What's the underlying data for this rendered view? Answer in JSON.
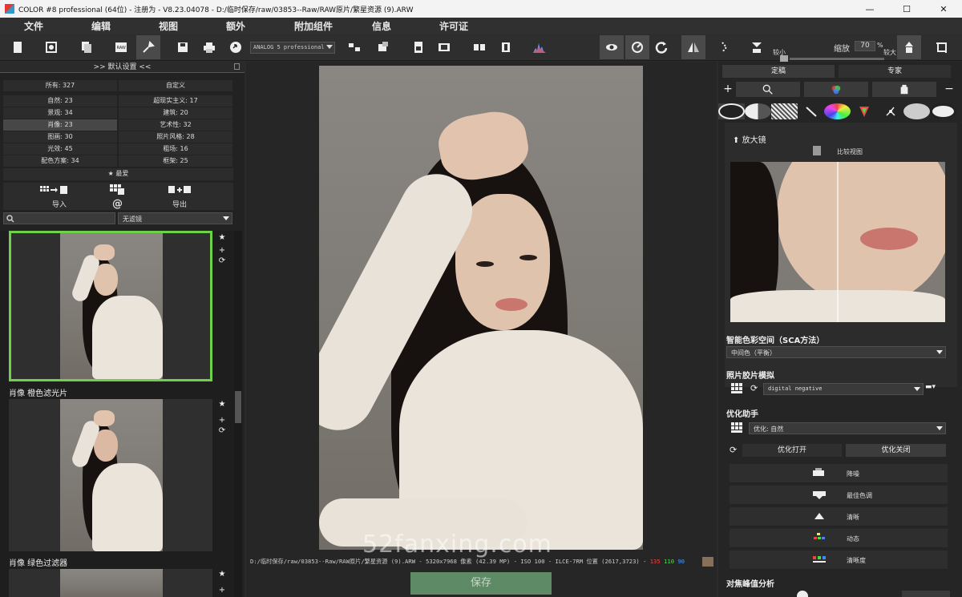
{
  "window": {
    "title": "COLOR #8 professional (64位) - 注册为 - V8.23.04078 - D:/临时保存/raw/03853--Raw/RAW原片/繁星资源 (9).ARW",
    "controls": [
      "—",
      "☐",
      "✕"
    ]
  },
  "menu": [
    "文件",
    "编辑",
    "视图",
    "额外",
    "附加组件",
    "信息",
    "许可证"
  ],
  "toolbar": {
    "preset_select": "ANALOG 5 professional",
    "size_small": "较小",
    "size_large": "较大",
    "zoom_label": "缩放",
    "zoom_value": "70",
    "zoom_unit": "%"
  },
  "left_panel": {
    "header": ">> 默认设置 <<",
    "categories_left": [
      {
        "label": "所有: 327"
      },
      {
        "label": "自然: 23"
      },
      {
        "label": "景观: 34"
      },
      {
        "label": "肖像: 23",
        "selected": true
      },
      {
        "label": "图画: 30"
      },
      {
        "label": "光效: 45"
      },
      {
        "label": "配色方案: 34"
      }
    ],
    "categories_right": [
      {
        "label": "自定义"
      },
      {
        "label": "超现实主义: 17"
      },
      {
        "label": "建筑: 20"
      },
      {
        "label": "艺术性: 32"
      },
      {
        "label": "照片风格: 28"
      },
      {
        "label": "粗场: 16"
      },
      {
        "label": "框架: 25"
      }
    ],
    "favorites": "最爱",
    "import_label": "导入",
    "export_label": "导出",
    "at_symbol": "@",
    "filter_select": "无滤镜",
    "thumbnails": [
      {
        "label": ""
      },
      {
        "label": "肖像  橙色滤光片"
      },
      {
        "label": "肖像  绿色过滤器"
      }
    ]
  },
  "status": {
    "path": "D:/临时保存/raw/03853--Raw/RAW原片/繁星资源 (9).ARW - 5320x7968 像素 (42.39 MP) - ISO 100 - ILCE-7RM 位置 (2617,3723) -",
    "r": "135",
    "g": "110",
    "b": "90",
    "swatch_color": "#87705a"
  },
  "save_button": "保存",
  "watermark": "52fanxing.com",
  "right_panel": {
    "tabs": [
      "定稿",
      "专家"
    ],
    "magnifier_title": "放大镜",
    "compare_label": "比较视图",
    "sca_title": "智能色彩空间（SCA方法）",
    "sca_select": "中间色（平衡）",
    "film_title": "照片胶片模拟",
    "film_select": "digital negative",
    "opt_title": "优化助手",
    "opt_select": "优化: 自然",
    "opt_on": "优化打开",
    "opt_off": "优化关闭",
    "options": [
      "降噪",
      "最佳色调",
      "清晰",
      "动态",
      "清晰度"
    ],
    "focus_title": "对焦峰值分析"
  }
}
